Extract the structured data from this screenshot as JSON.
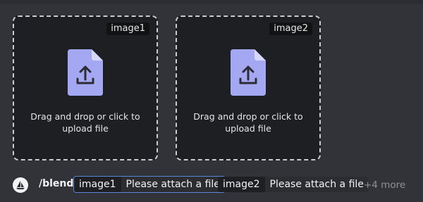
{
  "uploads": [
    {
      "label": "image1",
      "instruction": "Drag and drop or click to upload file",
      "icon": "file-upload-icon"
    },
    {
      "label": "image2",
      "instruction": "Drag and drop or click to upload file",
      "icon": "file-upload-icon"
    }
  ],
  "command": {
    "name": "/blend",
    "avatar_icon": "sailboat-icon",
    "options": [
      {
        "name": "image1",
        "value": "Please attach a file",
        "active": true
      },
      {
        "name": "image2",
        "value": "Please attach a file",
        "active": false
      }
    ],
    "more": "+4 more"
  },
  "colors": {
    "background": "#313338",
    "dropzone_bg": "#1e1f22",
    "icon_lavender": "#a4a8f2",
    "active_outline": "#5b86d8"
  }
}
